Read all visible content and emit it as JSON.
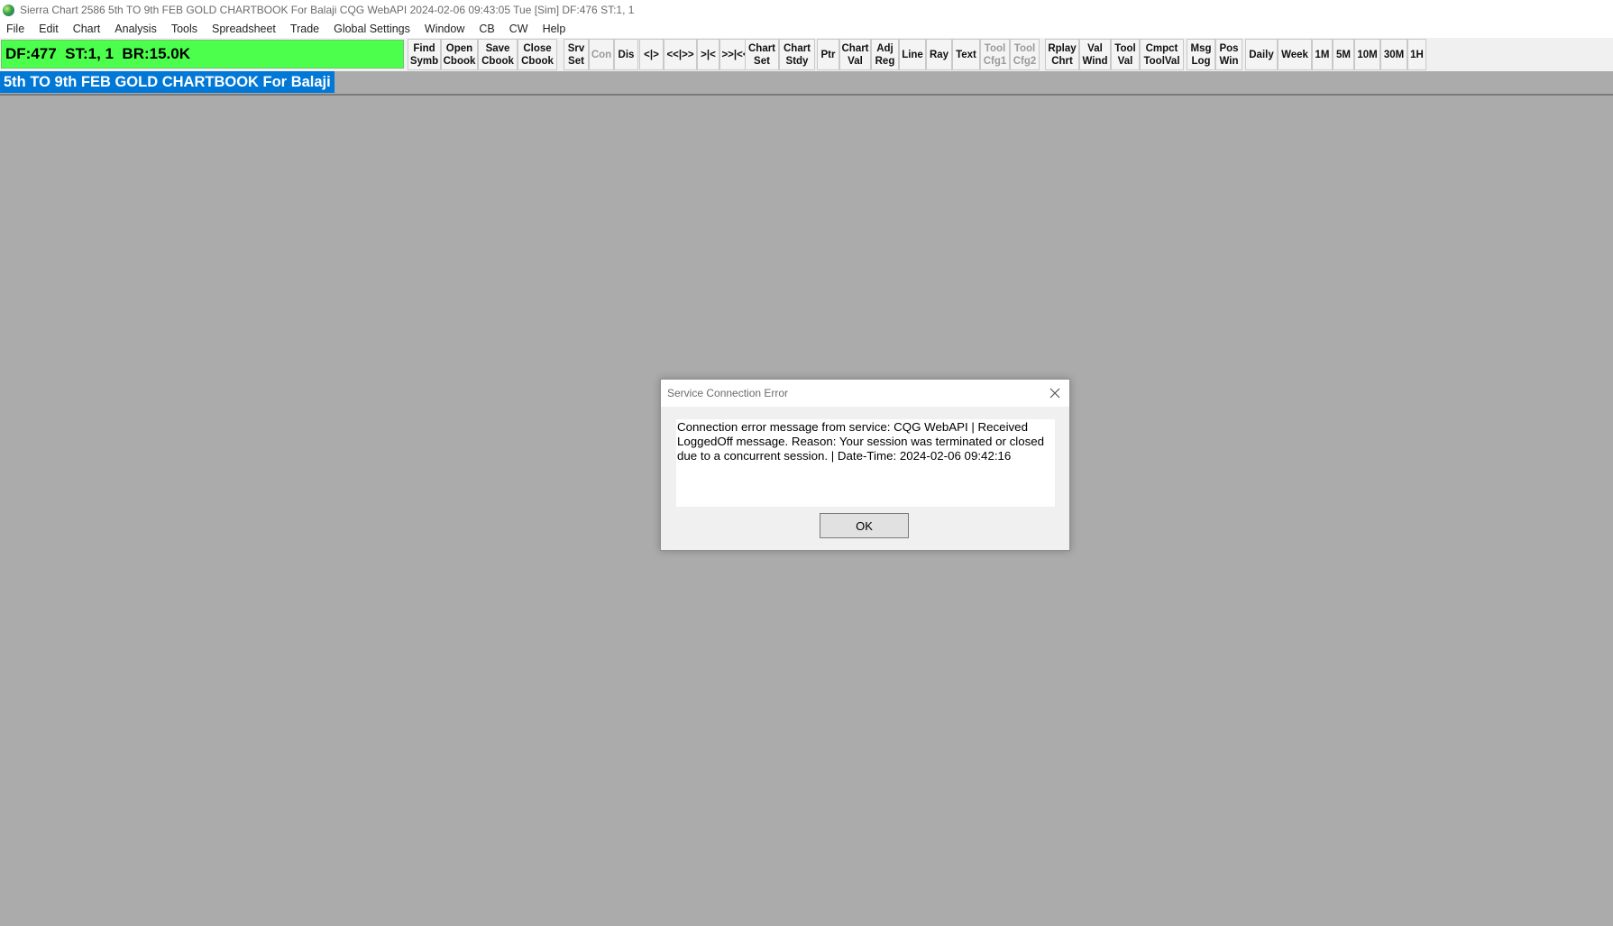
{
  "window": {
    "title": "Sierra Chart 2586 5th TO 9th FEB GOLD CHARTBOOK For Balaji CQG WebAPI 2024-02-06  09:43:05 Tue [Sim]  DF:476  ST:1, 1",
    "icon": "sierra-chart-globe-icon"
  },
  "menu": {
    "items": [
      "File",
      "Edit",
      "Chart",
      "Analysis",
      "Tools",
      "Spreadsheet",
      "Trade",
      "Global Settings",
      "Window",
      "CB",
      "CW",
      "Help"
    ]
  },
  "status": {
    "text": "DF:477  ST:1, 1  BR:15.0K",
    "color": "#4cff4c"
  },
  "toolbar": {
    "buttons": [
      {
        "label": "Find\nSymb",
        "enabled": true
      },
      {
        "label": "Open\nCbook",
        "enabled": true
      },
      {
        "label": "Save\nCbook",
        "enabled": true
      },
      {
        "label": "Close\nCbook",
        "enabled": true
      },
      {
        "label": "Srv\nSet",
        "enabled": true
      },
      {
        "label": "Con",
        "enabled": false
      },
      {
        "label": "Dis",
        "enabled": true
      },
      {
        "label": "<|>",
        "enabled": true
      },
      {
        "label": "<<|>>",
        "enabled": true
      },
      {
        "label": ">|<",
        "enabled": true
      },
      {
        "label": ">>|<<",
        "enabled": true
      },
      {
        "label": "Chart\nSet",
        "enabled": true
      },
      {
        "label": "Chart\nStdy",
        "enabled": true
      },
      {
        "label": "Ptr",
        "enabled": true
      },
      {
        "label": "Chart\nVal",
        "enabled": true
      },
      {
        "label": "Adj\nReg",
        "enabled": true
      },
      {
        "label": "Line",
        "enabled": true
      },
      {
        "label": "Ray",
        "enabled": true
      },
      {
        "label": "Text",
        "enabled": true
      },
      {
        "label": "Tool\nCfg1",
        "enabled": false
      },
      {
        "label": "Tool\nCfg2",
        "enabled": false
      },
      {
        "label": "Rplay\nChrt",
        "enabled": true
      },
      {
        "label": "Val\nWind",
        "enabled": true
      },
      {
        "label": "Tool\nVal",
        "enabled": true
      },
      {
        "label": "Cmpct\nToolVal",
        "enabled": true
      },
      {
        "label": "Msg\nLog",
        "enabled": true
      },
      {
        "label": "Pos\nWin",
        "enabled": true
      },
      {
        "label": "Daily",
        "enabled": true
      },
      {
        "label": "Week",
        "enabled": true
      },
      {
        "label": "1M",
        "enabled": true
      },
      {
        "label": "5M",
        "enabled": true
      },
      {
        "label": "10M",
        "enabled": true
      },
      {
        "label": "30M",
        "enabled": true
      },
      {
        "label": "1H",
        "enabled": true
      }
    ]
  },
  "chartbook_tab": {
    "label": "5th TO 9th FEB GOLD CHARTBOOK For Balaji",
    "color": "#0078d7"
  },
  "dialog": {
    "title": "Service Connection Error",
    "close_icon": "close-icon",
    "message": "Connection error message from service: CQG WebAPI | Received LoggedOff message. Reason: Your session was terminated or closed due to a concurrent session. | Date-Time: 2024-02-06  09:42:16",
    "ok_label": "OK"
  }
}
